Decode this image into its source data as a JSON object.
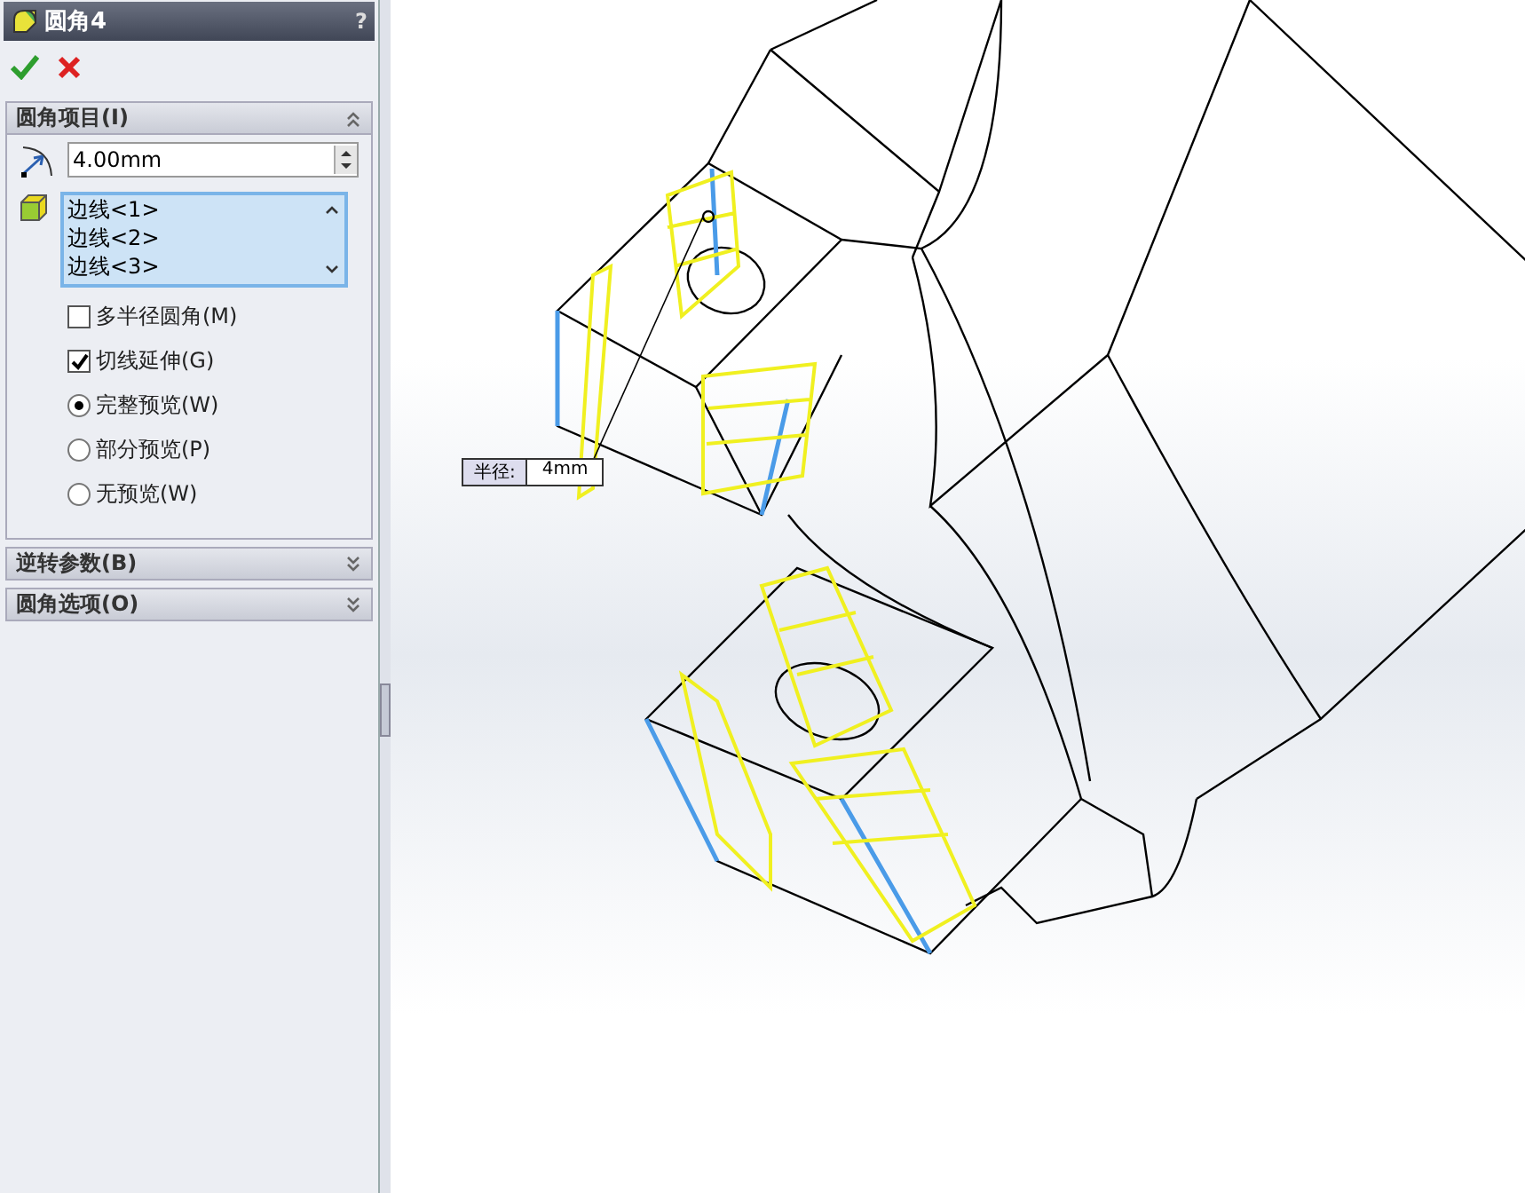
{
  "header": {
    "title": "圆角4",
    "help": "?"
  },
  "fillet_items": {
    "title": "圆角项目(I)",
    "expanded": true,
    "radius": "4.00mm",
    "edges": [
      "边线<1>",
      "边线<2>",
      "边线<3>"
    ],
    "options": [
      {
        "kind": "checkbox",
        "label": "多半径圆角(M)",
        "checked": false
      },
      {
        "kind": "checkbox",
        "label": "切线延伸(G)",
        "checked": true
      },
      {
        "kind": "radio",
        "label": "完整预览(W)",
        "selected": true
      },
      {
        "kind": "radio",
        "label": "部分预览(P)",
        "selected": false
      },
      {
        "kind": "radio",
        "label": "无预览(W)",
        "selected": false
      }
    ]
  },
  "collapsed_sections": [
    {
      "title": "逆转参数(B)",
      "expanded": false
    },
    {
      "title": "圆角选项(O)",
      "expanded": false
    }
  ],
  "callout": {
    "label": "半径:",
    "value": "4mm"
  }
}
